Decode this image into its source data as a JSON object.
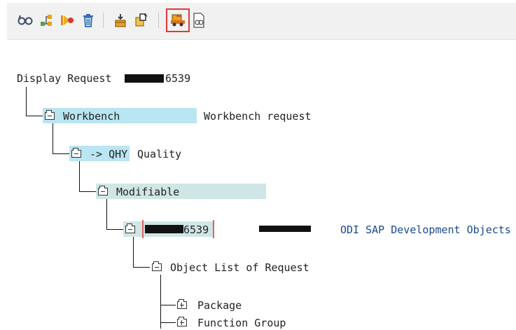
{
  "toolbar": {
    "buttons": [
      {
        "name": "display-change-icon"
      },
      {
        "name": "object-tree-icon"
      },
      {
        "name": "activate-icon"
      },
      {
        "name": "delete-icon"
      },
      {
        "name": "release-icon"
      },
      {
        "name": "copy-icon"
      },
      {
        "name": "transport-truck-icon",
        "highlighted": true
      },
      {
        "name": "display-object-icon"
      }
    ],
    "highlight_color": "#e03a3a"
  },
  "tree": {
    "header_label": "Display Request",
    "header_suffix": "6539",
    "workbench": {
      "label": "Workbench",
      "description": "Workbench request"
    },
    "quality": {
      "arrow": "-> QHY",
      "label": "Quality"
    },
    "modifiable": {
      "label": "Modifiable"
    },
    "request": {
      "suffix": "6539",
      "owner_redacted": "",
      "description": "ODI SAP Development Objects"
    },
    "object_list": {
      "label": "Object List of Request"
    },
    "children": [
      {
        "label": "Package"
      },
      {
        "label": "Function Group"
      }
    ]
  },
  "colors": {
    "selection": "#b9e6f2",
    "description_blue": "#1a4a8c"
  }
}
